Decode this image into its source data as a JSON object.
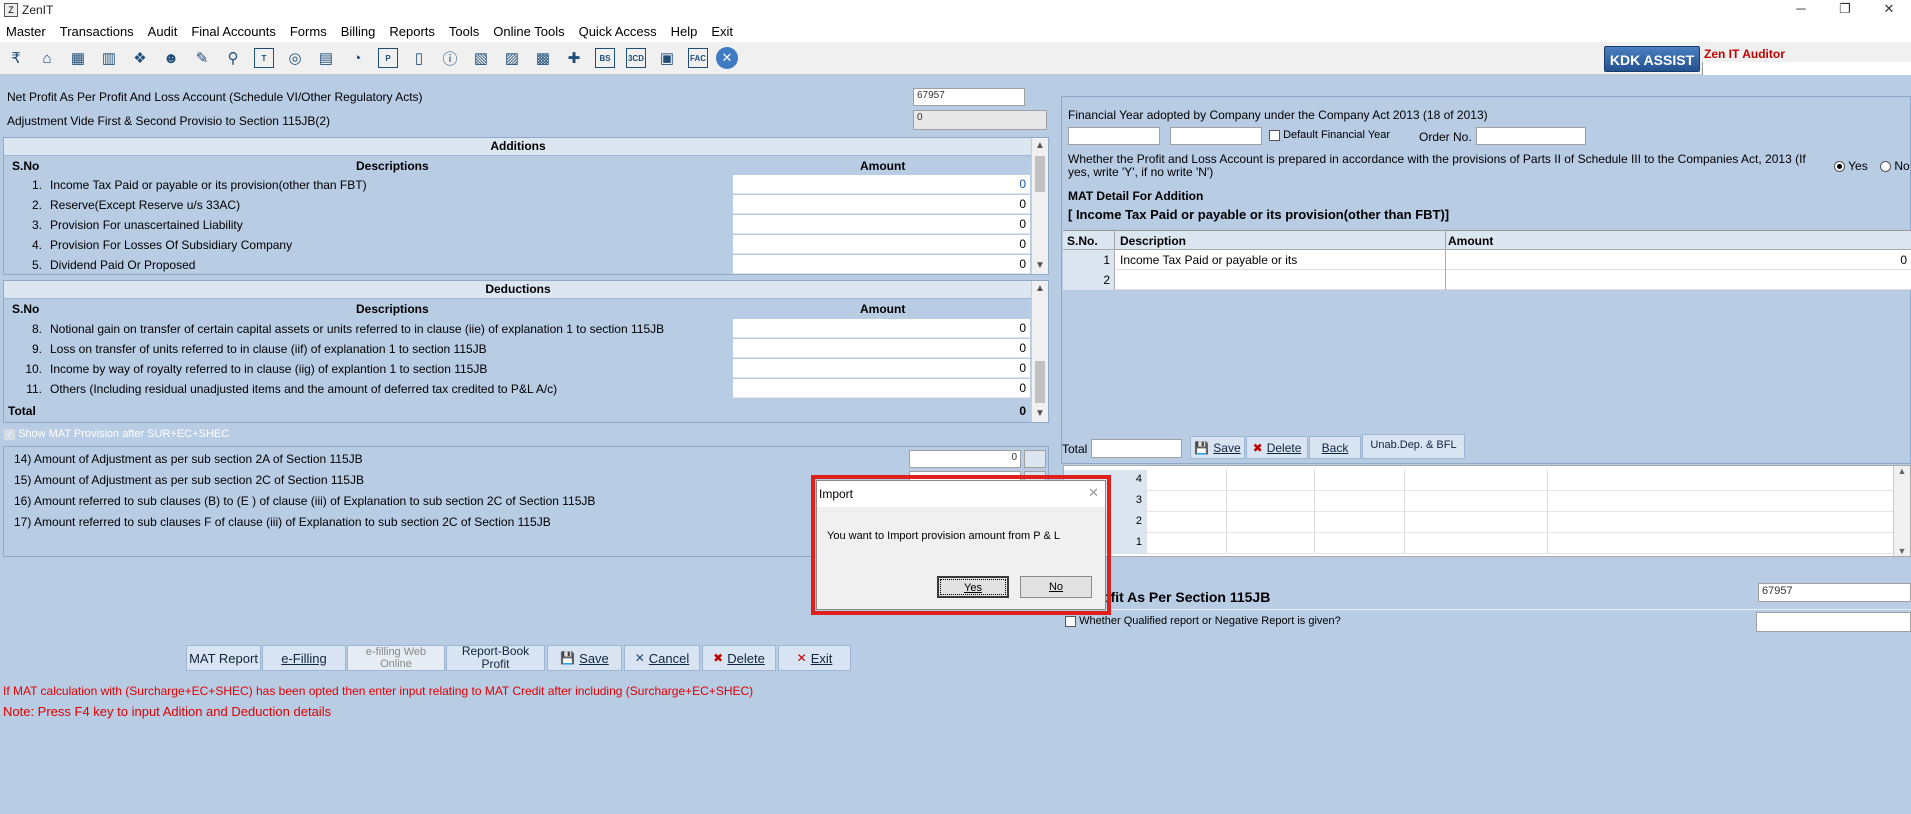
{
  "window": {
    "title": "ZenIT",
    "app_icon": "Z",
    "minimize": "─",
    "restore": "❐",
    "close": "✕"
  },
  "menu": [
    "Master",
    "Transactions",
    "Audit",
    "Final Accounts",
    "Forms",
    "Billing",
    "Reports",
    "Tools",
    "Online Tools",
    "Quick Access",
    "Help",
    "Exit"
  ],
  "toolbar": {
    "icons": [
      "rupee-icon",
      "home-icon",
      "building-icon",
      "bar-chart-icon",
      "gift-icon",
      "users-icon",
      "pin-icon",
      "filter-icon",
      "tax-icon",
      "disc-icon",
      "calculator-icon",
      "pie-chart-icon",
      "pay-icon",
      "book-icon",
      "info-icon",
      "report-icon",
      "form-icon",
      "calendar-icon",
      "add-document-icon",
      "bs-icon",
      "3cd-icon",
      "ledger-icon",
      "fac-icon",
      "close-circle-icon"
    ],
    "glyphs": [
      "₹",
      "⌂",
      "▦",
      "▥",
      "❖",
      "☻",
      "✎",
      "⚲",
      "T",
      "◎",
      "▤",
      "◔",
      "P",
      "▯",
      "ⓘ",
      "▧",
      "▨",
      "▩",
      "✚",
      "BS",
      "3CD",
      "▣",
      "FAC",
      "✕"
    ],
    "kdk_assist": "KDK ASSIST",
    "zen_auditor": "Zen IT Auditor"
  },
  "left": {
    "net_profit_label": "Net Profit As Per Profit And Loss Account (Schedule VI/Other Regulatory Acts)",
    "net_profit_value": "67957",
    "adjustment_label": "Adjustment Vide First & Second Provisio to Section 115JB(2)",
    "adjustment_value": "0",
    "additions": {
      "title": "Additions",
      "col_sno": "S.No",
      "col_desc": "Descriptions",
      "col_amt": "Amount",
      "rows": [
        {
          "no": "1.",
          "desc": "Income Tax Paid or payable or its provision(other than FBT)",
          "amt": "0"
        },
        {
          "no": "2.",
          "desc": "Reserve(Except Reserve u/s 33AC)",
          "amt": "0"
        },
        {
          "no": "3.",
          "desc": "Provision For unascertained Liability",
          "amt": "0"
        },
        {
          "no": "4.",
          "desc": "Provision For Losses Of Subsidiary Company",
          "amt": "0"
        },
        {
          "no": "5.",
          "desc": "Dividend Paid Or Proposed",
          "amt": "0"
        }
      ]
    },
    "deductions": {
      "title": "Deductions",
      "col_sno": "S.No",
      "col_desc": "Descriptions",
      "col_amt": "Amount",
      "rows": [
        {
          "no": "8.",
          "desc": "Notional gain on transfer of certain capital assets or units referred to in clause (iie) of explanation 1 to section 115JB",
          "amt": "0"
        },
        {
          "no": "9.",
          "desc": "Loss on transfer of units referred to in clause (iif) of explanation 1 to section 115JB",
          "amt": "0"
        },
        {
          "no": "10.",
          "desc": "Income by way of royalty referred to in clause (iig) of explantion 1 to section 115JB",
          "amt": "0"
        },
        {
          "no": "11.",
          "desc": "Others (Including residual unadjusted items and the amount of deferred tax credited to P&L A/c)",
          "amt": "0"
        }
      ],
      "total_label": "Total",
      "total_value": "0"
    },
    "show_mat_label": "Show MAT Provision after SUR+EC+SHEC",
    "adjustments": [
      {
        "label": "14)  Amount of Adjustment as per sub section 2A of Section 115JB",
        "value": "0"
      },
      {
        "label": "15) Amount of Adjustment as per sub section 2C of Section 115JB",
        "value": ""
      },
      {
        "label": "16) Amount referred to sub clauses (B) to (E ) of clause (iii) of Explanation to sub section 2C of Section 115JB",
        "value": ""
      },
      {
        "label": "17) Amount referred to sub clauses F of clause (iii) of Explanation to sub section 2C of Section 115JB",
        "value": ""
      }
    ],
    "buttons": {
      "mat_report": "MAT Report",
      "efilling": "e-Filling",
      "efilling_web": "e-filling Web Online",
      "report_book": "Report-Book Profit",
      "save": "Save",
      "cancel": "Cancel",
      "delete": "Delete",
      "exit": "Exit"
    },
    "note1": "If MAT calculation with (Surcharge+EC+SHEC) has been opted then enter input relating to MAT Credit after including (Surcharge+EC+SHEC)",
    "note2": "Note: Press F4 key to input Adition and Deduction details"
  },
  "right": {
    "fy_label": "Financial Year adopted by Company under the Company Act 2013 (18 of 2013)",
    "default_fy_label": "Default Financial Year",
    "order_no_label": "Order No.",
    "pl_question": "Whether the Profit and Loss Account is prepared in accordance with the provisions of Parts II of Schedule III to the Companies Act, 2013 (If yes, write 'Y', if no write 'N')",
    "yes": "Yes",
    "no": "No",
    "mat_detail_title": "MAT Detail For Addition",
    "mat_detail_sub": "[ Income Tax Paid or payable or its provision(other than FBT)]",
    "grid": {
      "col_sno": "S.No.",
      "col_desc": "Description",
      "col_amt": "Amount",
      "rows": [
        {
          "no": "1",
          "desc": "Income Tax Paid or payable or its",
          "amt": "0"
        },
        {
          "no": "2",
          "desc": "",
          "amt": ""
        }
      ]
    },
    "total_label": "Total",
    "save": "Save",
    "delete": "Delete",
    "back": "Back",
    "unab_dep": "Unab.Dep. & BFL",
    "lower_grid_rows": [
      "4",
      "3",
      "2",
      "1"
    ],
    "profit_label": "ofit As Per Section 115JB",
    "profit_value": "67957",
    "qualified_label": "Whether Qualified report or Negative Report is given?"
  },
  "dialog": {
    "title": "Import",
    "close": "✕",
    "message": "You want to Import provision amount from P & L",
    "yes": "Yes",
    "no": "No"
  }
}
